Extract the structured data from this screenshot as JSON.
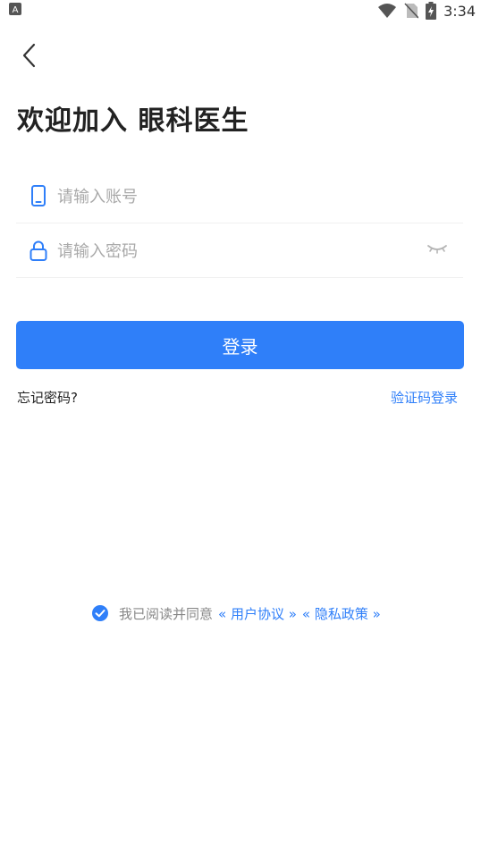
{
  "status_bar": {
    "time": "3:34",
    "left_badge": "A"
  },
  "header": {
    "title": "欢迎加入 眼科医生"
  },
  "form": {
    "account_placeholder": "请输入账号",
    "password_placeholder": "请输入密码"
  },
  "actions": {
    "login_label": "登录",
    "forgot_label": "忘记密码?",
    "code_login_label": "验证码登录"
  },
  "agreement": {
    "prefix": "我已阅读并同意",
    "user_agreement": "« 用户协议 »",
    "privacy_policy": "« 隐私政策 »",
    "checked": true
  },
  "colors": {
    "accent": "#2f7ff9",
    "text": "#222222",
    "placeholder": "#a9a9a9"
  }
}
